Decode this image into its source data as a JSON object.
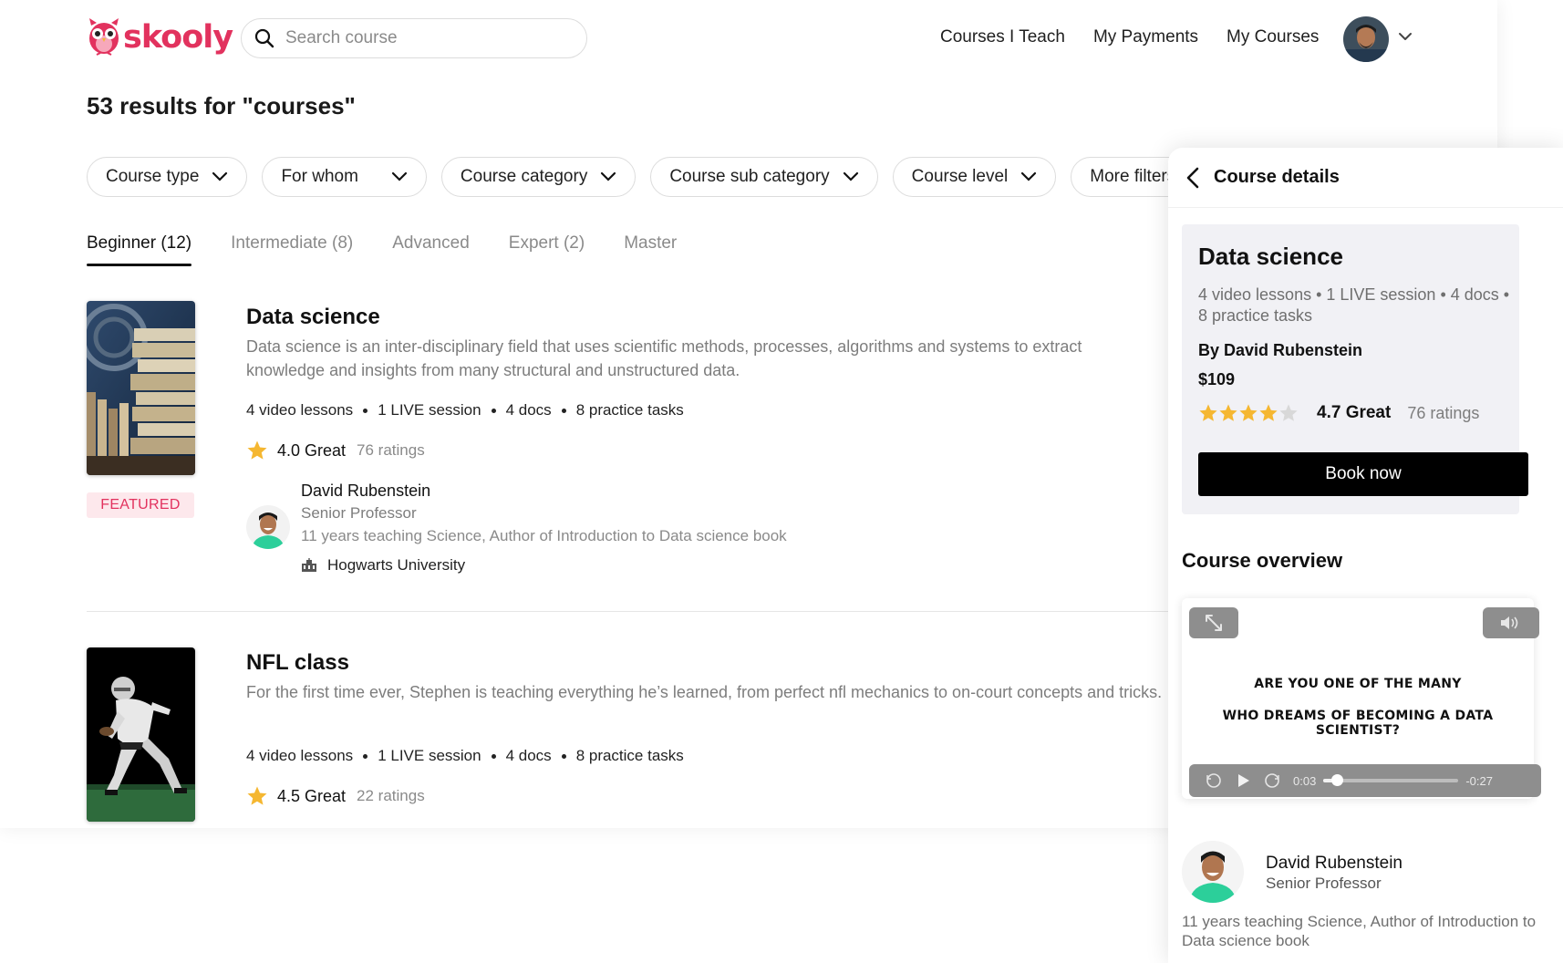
{
  "header": {
    "brand": "skooly",
    "search_placeholder": "Search course",
    "nav": [
      "Courses I Teach",
      "My Payments",
      "My Courses"
    ]
  },
  "results_title": "53 results for \"courses\"",
  "filters": [
    "Course type",
    "For whom",
    "Course category",
    "Course sub category",
    "Course level",
    "More filters"
  ],
  "tabs": [
    "Beginner (12)",
    "Intermediate (8)",
    "Advanced",
    "Expert (2)",
    "Master"
  ],
  "active_tab": 0,
  "courses": [
    {
      "title": "Data science",
      "badge": "FEATURED",
      "description": "Data science is an inter-disciplinary field that uses scientific methods, processes, algorithms and systems to extract knowledge and insights from many structural and unstructured data.",
      "meta": [
        "4 video lessons",
        "1 LIVE session",
        "4 docs",
        "8 practice tasks"
      ],
      "rating": "4.0 Great",
      "rating_count": "76 ratings",
      "instructor": {
        "name": "David Rubenstein",
        "role": "Senior Professor",
        "bio": "11 years teaching Science, Author of Introduction to Data science book",
        "university": "Hogwarts University"
      }
    },
    {
      "title": "NFL class",
      "description": "For the first time ever, Stephen is teaching everything he’s learned, from perfect nfl mechanics to on-court concepts and tricks.",
      "meta": [
        "4 video lessons",
        "1 LIVE session",
        "4 docs",
        "8 practice tasks"
      ],
      "rating": "4.5 Great",
      "rating_count": "22 ratings"
    }
  ],
  "panel": {
    "header": "Course details",
    "course_name": "Data science",
    "meta": "4 video lessons  •  1 LIVE session  •  4 docs  •  8 practice tasks",
    "by": "By David Rubenstein",
    "price": "$109",
    "stars": 4,
    "rating": "4.7 Great",
    "rating_count": "76 ratings",
    "book_label": "Book now",
    "overview_title": "Course overview",
    "video": {
      "line1": "ARE YOU ONE OF THE MANY",
      "line2": "WHO DREAMS OF BECOMING A DATA SCIENTIST?",
      "elapsed": "0:03",
      "remaining": "-0:27",
      "progress": 0.1
    },
    "instructor_name": "David Rubenstein",
    "instructor_role": "Senior Professor",
    "instructor_bio": "11 years teaching Science, Author of Introduction to Data science book"
  },
  "colors": {
    "brand": "#e2325e",
    "star": "#f5b731",
    "star_empty": "#d8d8d8"
  }
}
